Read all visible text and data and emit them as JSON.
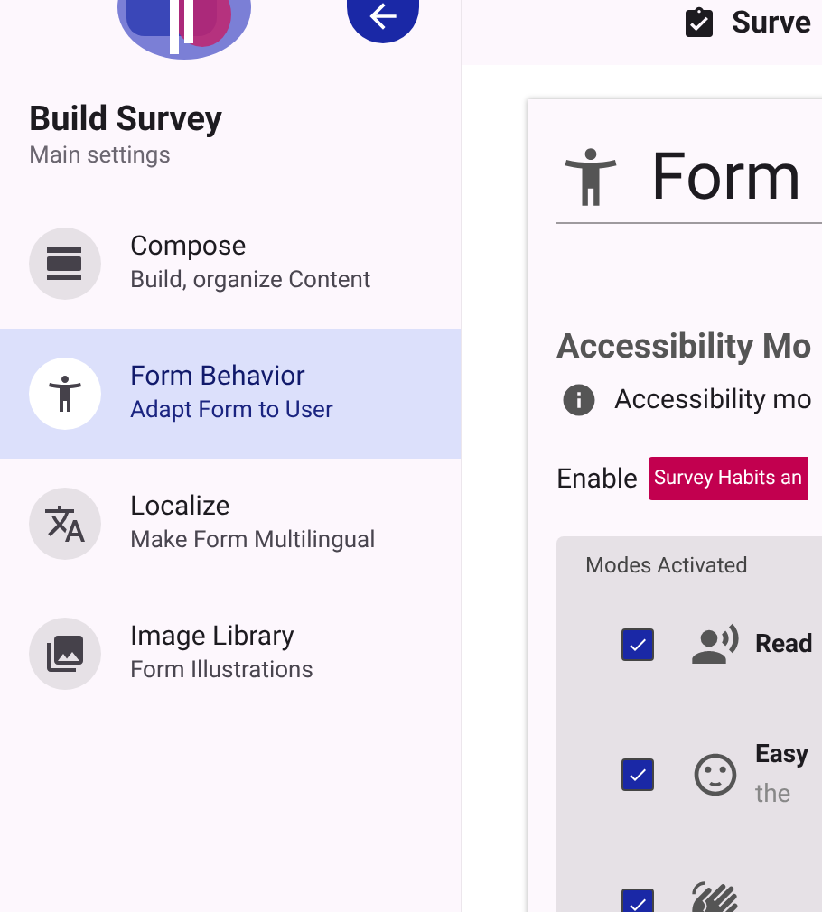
{
  "header": {
    "title": "Surve"
  },
  "sidebar": {
    "title": "Build Survey",
    "subtitle": "Main settings",
    "items": [
      {
        "kind": "compose",
        "label": "Compose",
        "description": "Build, organize Content",
        "selected": false
      },
      {
        "kind": "behavior",
        "label": "Form Behavior",
        "description": "Adapt Form to User",
        "selected": true
      },
      {
        "kind": "localize",
        "label": "Localize",
        "description": "Make Form Multilingual",
        "selected": false
      },
      {
        "kind": "images",
        "label": "Image Library",
        "description": "Form Illustrations",
        "selected": false
      }
    ]
  },
  "card": {
    "title": "Form",
    "section_title": "Accessibility Mo",
    "info": "Accessibility mo",
    "enable_label": "Enable",
    "enable_badge": "Survey Habits an",
    "modes": {
      "title": "Modes Activated",
      "items": [
        {
          "kind": "voice",
          "label": "Read",
          "checked": true
        },
        {
          "kind": "face",
          "label": "Easy",
          "description": "the",
          "checked": true
        },
        {
          "kind": "hand",
          "checked": true
        }
      ]
    }
  }
}
